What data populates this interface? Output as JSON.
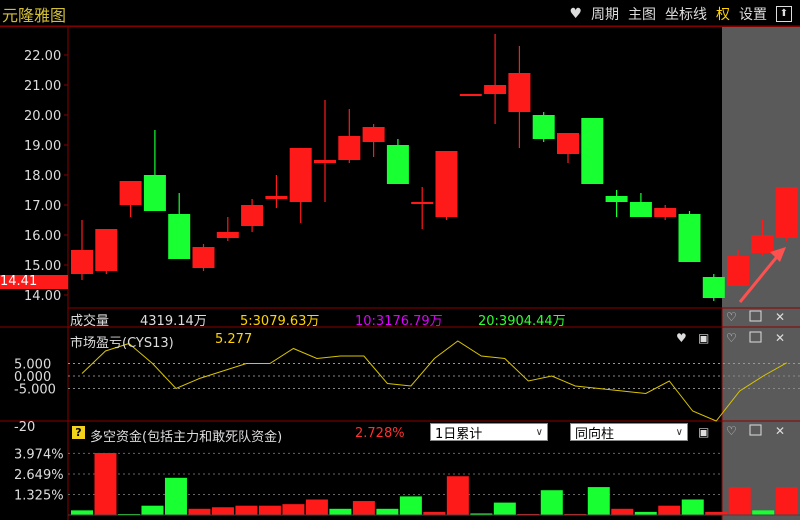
{
  "title": "元隆雅图",
  "menu": {
    "heart": "♥",
    "period": "周期",
    "main_chart": "主图",
    "coord_line": "坐标线",
    "rights": "权",
    "settings": "设置",
    "up": "⬆"
  },
  "price_axis": {
    "ticks": [
      "22.00",
      "21.00",
      "20.00",
      "19.00",
      "18.00",
      "17.00",
      "16.00",
      "15.00",
      "14.00"
    ],
    "current_price": "14.41"
  },
  "candles": [
    {
      "o": 14.7,
      "c": 15.5,
      "h": 16.5,
      "l": 14.5
    },
    {
      "o": 14.8,
      "c": 16.2,
      "h": 16.2,
      "l": 14.7
    },
    {
      "o": 17.0,
      "c": 17.8,
      "h": 17.8,
      "l": 16.6
    },
    {
      "o": 18.0,
      "c": 16.8,
      "h": 19.5,
      "l": 16.8
    },
    {
      "o": 16.7,
      "c": 15.2,
      "h": 17.4,
      "l": 15.2
    },
    {
      "o": 14.9,
      "c": 15.6,
      "h": 15.7,
      "l": 14.8
    },
    {
      "o": 15.9,
      "c": 16.1,
      "h": 16.6,
      "l": 15.8
    },
    {
      "o": 16.3,
      "c": 17.0,
      "h": 17.2,
      "l": 16.1
    },
    {
      "o": 17.2,
      "c": 17.3,
      "h": 18.0,
      "l": 16.9
    },
    {
      "o": 17.1,
      "c": 18.9,
      "h": 18.9,
      "l": 16.4
    },
    {
      "o": 18.4,
      "c": 18.5,
      "h": 20.5,
      "l": 17.1
    },
    {
      "o": 18.5,
      "c": 19.3,
      "h": 20.2,
      "l": 18.4
    },
    {
      "o": 19.1,
      "c": 19.6,
      "h": 19.7,
      "l": 18.6
    },
    {
      "o": 19.0,
      "c": 17.7,
      "h": 19.2,
      "l": 17.7
    },
    {
      "o": 17.1,
      "c": 17.1,
      "h": 17.6,
      "l": 16.2
    },
    {
      "o": 16.6,
      "c": 18.8,
      "h": 18.8,
      "l": 16.5
    },
    {
      "o": 20.7,
      "c": 20.7,
      "h": 20.7,
      "l": 20.7
    },
    {
      "o": 20.7,
      "c": 21.0,
      "h": 22.7,
      "l": 19.7
    },
    {
      "o": 20.1,
      "c": 21.4,
      "h": 22.3,
      "l": 18.9
    },
    {
      "o": 20.0,
      "c": 19.2,
      "h": 20.1,
      "l": 19.1
    },
    {
      "o": 18.7,
      "c": 19.4,
      "h": 19.4,
      "l": 18.4
    },
    {
      "o": 19.9,
      "c": 17.7,
      "h": 19.9,
      "l": 17.7
    },
    {
      "o": 17.3,
      "c": 17.1,
      "h": 17.5,
      "l": 16.6
    },
    {
      "o": 17.1,
      "c": 16.6,
      "h": 17.4,
      "l": 16.6
    },
    {
      "o": 16.6,
      "c": 16.9,
      "h": 17.0,
      "l": 16.5
    },
    {
      "o": 16.7,
      "c": 15.1,
      "h": 16.8,
      "l": 15.1
    },
    {
      "o": 14.6,
      "c": 13.9,
      "h": 14.7,
      "l": 13.8
    },
    {
      "o": 14.3,
      "c": 15.3,
      "h": 15.5,
      "l": 14.3
    },
    {
      "o": 15.4,
      "c": 16.0,
      "h": 16.5,
      "l": 15.3
    },
    {
      "o": 15.9,
      "c": 17.6,
      "h": 17.6,
      "l": 15.8
    }
  ],
  "volume_bar": {
    "label": "成交量",
    "value": "4319.14万",
    "ma5": "5:3079.63万",
    "ma10": "10:3176.79万",
    "ma20": "20:3904.44万"
  },
  "cys": {
    "label": "市场盈亏(CYS13)",
    "value": "5.277",
    "ticks": [
      "5.000",
      "0.000",
      "-5.000",
      "-20"
    ],
    "values": [
      1,
      10,
      13,
      5,
      -5,
      -1,
      2,
      5,
      5,
      11,
      7,
      8,
      8,
      -3,
      -4,
      7,
      14,
      8,
      7,
      -2,
      0,
      -4,
      -5,
      -6,
      -7,
      -2,
      -14,
      -18,
      -6,
      0,
      5.3
    ]
  },
  "fund": {
    "label": "多空资金(包括主力和敢死队资金)",
    "value": "2.728%",
    "dropdown1": "1日累计",
    "dropdown2": "同向柱",
    "ticks": [
      "3.974%",
      "2.649%",
      "1.325%"
    ],
    "bars": [
      0.3,
      4.0,
      0.0,
      0.6,
      2.4,
      0.4,
      0.5,
      0.6,
      0.6,
      0.7,
      1.0,
      0.4,
      0.9,
      0.4,
      1.2,
      0.2,
      2.5,
      0.1,
      0.8,
      0.0,
      1.6,
      0.0,
      1.8,
      0.4,
      0.2,
      0.6,
      1.0,
      0.2,
      1.8,
      0.3,
      1.8
    ],
    "colors": [
      "G",
      "R",
      "G",
      "G",
      "G",
      "R",
      "R",
      "R",
      "R",
      "R",
      "R",
      "G",
      "R",
      "G",
      "G",
      "R",
      "R",
      "G",
      "G",
      "R",
      "G",
      "R",
      "G",
      "R",
      "G",
      "R",
      "G",
      "R",
      "R",
      "G",
      "R"
    ]
  },
  "colors": {
    "up": "#ff1a1a",
    "down": "#18ff32",
    "axis_red": "#8a0000",
    "gold": "#d4c038"
  },
  "bottom_marker": "14.41"
}
